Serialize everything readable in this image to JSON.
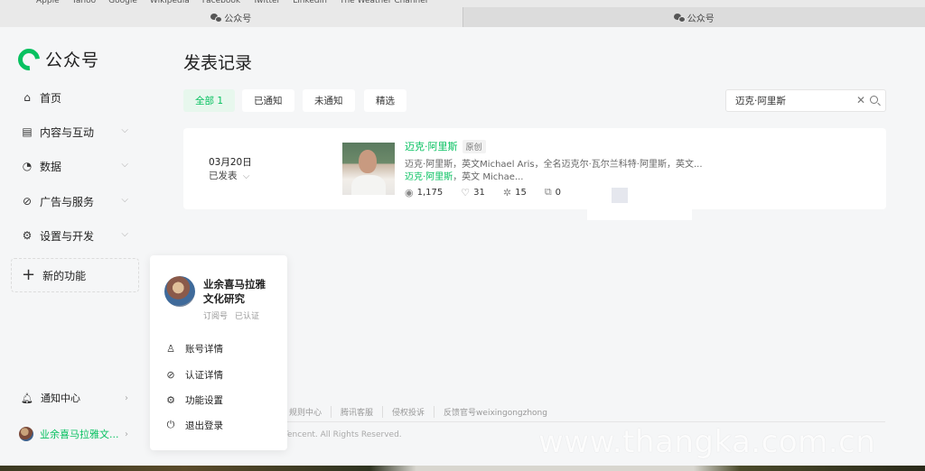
{
  "browser": {
    "bookmarks": [
      "Apple",
      "Yahoo",
      "Google",
      "Wikipedia",
      "Facebook",
      "Twitter",
      "LinkedIn",
      "The Weather Channel"
    ],
    "tabs": [
      {
        "label": "公众号",
        "active": true
      },
      {
        "label": "公众号",
        "active": false
      }
    ]
  },
  "sidebar": {
    "logo": "公众号",
    "items": [
      {
        "label": "首页",
        "icon": "home-icon"
      },
      {
        "label": "内容与互动",
        "icon": "document-icon"
      },
      {
        "label": "数据",
        "icon": "pie-chart-icon"
      },
      {
        "label": "广告与服务",
        "icon": "compass-icon"
      },
      {
        "label": "设置与开发",
        "icon": "gear-icon"
      }
    ],
    "new_feature": "新的功能",
    "notifications": "通知中心",
    "account_name": "业余喜马拉雅文..."
  },
  "main": {
    "title": "发表记录",
    "filters": [
      {
        "label": "全部 1",
        "active": true
      },
      {
        "label": "已通知",
        "active": false
      },
      {
        "label": "未通知",
        "active": false
      },
      {
        "label": "精选",
        "active": false
      }
    ],
    "search_value": "迈克·阿里斯",
    "article": {
      "date": "03月20日",
      "status": "已发表",
      "title": "迈克·阿里斯",
      "tag": "原创",
      "desc_line1": "迈克·阿里斯，英文Michael Aris，全名迈克尔·瓦尔兰科特·阿里斯，英文...",
      "desc_line2_hl": "迈克·阿里斯",
      "desc_line2_rest": "，英文 Michae...",
      "stats": {
        "reads": "1,175",
        "likes": "31",
        "shares": "15",
        "wow": "0"
      }
    }
  },
  "footer": {
    "links": [
      "规则中心",
      "腾讯客服",
      "侵权投诉",
      "反馈官号weixingongzhong"
    ],
    "copyright": "Tencent. All Rights Reserved."
  },
  "popup": {
    "name": "业余喜马拉雅文化研究",
    "type": "订阅号",
    "verified": "已认证",
    "menu": [
      {
        "label": "账号详情",
        "icon": "user-icon"
      },
      {
        "label": "认证详情",
        "icon": "check-circle-icon"
      },
      {
        "label": "功能设置",
        "icon": "gear-icon"
      },
      {
        "label": "退出登录",
        "icon": "power-icon"
      }
    ]
  },
  "watermark": "www.thangka.com.cn",
  "colors": {
    "accent": "#07c160",
    "background": "#f5f6f7"
  }
}
